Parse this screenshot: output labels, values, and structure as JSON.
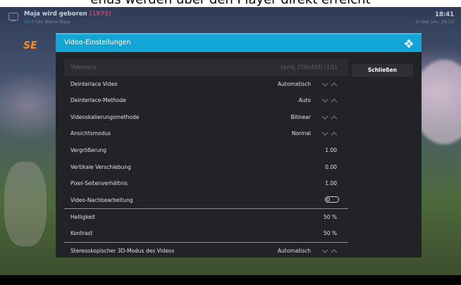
{
  "caption": "enüs werden über den Player direkt erreicht",
  "osd": {
    "title": "Maja wird geboren",
    "year": "(1975)",
    "channel_number": "16:0",
    "channel_name": "Die Biene Maja",
    "time": "18:41",
    "ends_label": "Endet um: 18:53"
  },
  "logo": "SE",
  "dialog": {
    "title": "Video-Einstellungen",
    "close_label": "Schließen",
    "rows": [
      {
        "label": "Videospur",
        "value": "(xvid, 720x400) (1/1)"
      },
      {
        "label": "Deinterlace Video",
        "value": "Automatisch"
      },
      {
        "label": "Deinterlace-Methode",
        "value": "Auto"
      },
      {
        "label": "Videoskalierungsmethode",
        "value": "Bilinear"
      },
      {
        "label": "Ansichtsmodus",
        "value": "Normal"
      },
      {
        "label": "Vergrößerung",
        "value": "1.00"
      },
      {
        "label": "Vertikale Verschiebung",
        "value": "0.00"
      },
      {
        "label": "Pixel-Seitenverhältnis",
        "value": "1.00"
      },
      {
        "label": "Video-Nachbearbeitung",
        "value": ""
      },
      {
        "label": "Helligkeit",
        "value": "50 %"
      },
      {
        "label": "Kontrast",
        "value": "50 %"
      },
      {
        "label": "Stereoskopischer 3D-Modus des Videos",
        "value": "Automatisch"
      }
    ]
  },
  "colors": {
    "accent": "#12a6d6",
    "dialog_bg": "#222326",
    "logo": "#ff8c1a"
  }
}
